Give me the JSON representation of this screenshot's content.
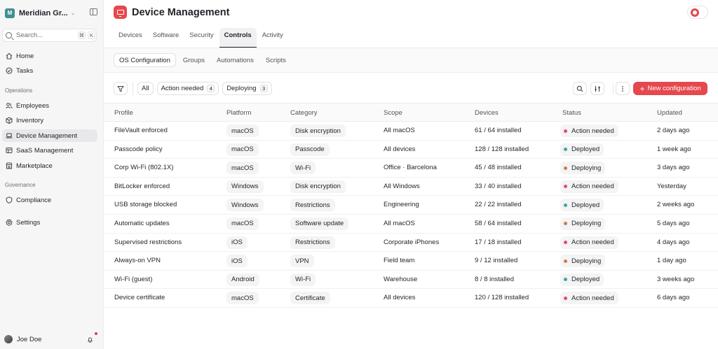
{
  "sidebar": {
    "workspace": {
      "initial": "M",
      "name": "Meridian Gr..."
    },
    "search": {
      "placeholder": "Search...",
      "kbd1": "⌘",
      "kbd2": "K"
    },
    "items_top": [
      {
        "label": "Home",
        "icon": "home-icon"
      },
      {
        "label": "Tasks",
        "icon": "check-circle-icon"
      }
    ],
    "section_operations": "Operations",
    "items_operations": [
      {
        "label": "Employees",
        "icon": "people-icon"
      },
      {
        "label": "Inventory",
        "icon": "box-icon"
      },
      {
        "label": "Device Management",
        "icon": "laptop-icon",
        "active": true
      },
      {
        "label": "SaaS Management",
        "icon": "apps-icon"
      },
      {
        "label": "Marketplace",
        "icon": "store-icon"
      }
    ],
    "section_governance": "Governance",
    "items_governance": [
      {
        "label": "Compliance",
        "icon": "shield-icon"
      }
    ],
    "settings": {
      "label": "Settings",
      "icon": "gear-icon"
    },
    "user": {
      "name": "Joe Doe"
    }
  },
  "header": {
    "title": "Device Management",
    "icon": "monitor-icon"
  },
  "tabs": [
    "Devices",
    "Software",
    "Security",
    "Controls",
    "Activity"
  ],
  "active_tab": "Controls",
  "subtabs": [
    "OS Configuration",
    "Groups",
    "Automations",
    "Scripts"
  ],
  "active_subtab": "OS Configuration",
  "filters": {
    "all": "All",
    "action_needed": {
      "label": "Action needed",
      "count": "4"
    },
    "deploying": {
      "label": "Deploying",
      "count": "3"
    }
  },
  "new_button": "New configuration",
  "table": {
    "columns": [
      "Profile",
      "Platform",
      "Category",
      "Scope",
      "Devices",
      "Status",
      "Updated"
    ],
    "rows": [
      {
        "profile": "FileVault enforced",
        "platform": "macOS",
        "category": "Disk encryption",
        "scope": "All macOS",
        "devices": "61 / 64 installed",
        "status": "Action needed",
        "updated": "2 days ago"
      },
      {
        "profile": "Passcode policy",
        "platform": "macOS",
        "category": "Passcode",
        "scope": "All devices",
        "devices": "128 / 128 installed",
        "status": "Deployed",
        "updated": "1 week ago"
      },
      {
        "profile": "Corp Wi-Fi (802.1X)",
        "platform": "macOS",
        "category": "Wi-Fi",
        "scope": "Office · Barcelona",
        "devices": "45 / 48 installed",
        "status": "Deploying",
        "updated": "3 days ago"
      },
      {
        "profile": "BitLocker enforced",
        "platform": "Windows",
        "category": "Disk encryption",
        "scope": "All Windows",
        "devices": "33 / 40 installed",
        "status": "Action needed",
        "updated": "Yesterday"
      },
      {
        "profile": "USB storage blocked",
        "platform": "Windows",
        "category": "Restrictions",
        "scope": "Engineering",
        "devices": "22 / 22 installed",
        "status": "Deployed",
        "updated": "2 weeks ago"
      },
      {
        "profile": "Automatic updates",
        "platform": "macOS",
        "category": "Software update",
        "scope": "All macOS",
        "devices": "58 / 64 installed",
        "status": "Deploying",
        "updated": "5 days ago"
      },
      {
        "profile": "Supervised restrictions",
        "platform": "iOS",
        "category": "Restrictions",
        "scope": "Corporate iPhones",
        "devices": "17 / 18 installed",
        "status": "Action needed",
        "updated": "4 days ago"
      },
      {
        "profile": "Always-on VPN",
        "platform": "iOS",
        "category": "VPN",
        "scope": "Field team",
        "devices": "9 / 12 installed",
        "status": "Deploying",
        "updated": "1 day ago"
      },
      {
        "profile": "Wi-Fi (guest)",
        "platform": "Android",
        "category": "Wi-Fi",
        "scope": "Warehouse",
        "devices": "8 / 8 installed",
        "status": "Deployed",
        "updated": "3 weeks ago"
      },
      {
        "profile": "Device certificate",
        "platform": "macOS",
        "category": "Certificate",
        "scope": "All devices",
        "devices": "120 / 128 installed",
        "status": "Action needed",
        "updated": "6 days ago"
      }
    ]
  },
  "status_colors": {
    "Action needed": "#e5487a",
    "Deployed": "#3fa7a0",
    "Deploying": "#d07a4f"
  },
  "accent": "#e5484d"
}
